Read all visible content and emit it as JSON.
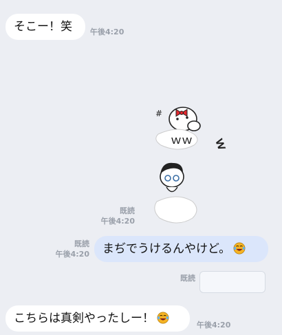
{
  "messages": [
    {
      "id": "m1",
      "direction": "incoming",
      "text": "そこー！笑",
      "time": "午後4:20"
    },
    {
      "id": "m2",
      "direction": "outgoing",
      "type": "sticker",
      "sticker_text": "ｗｗ",
      "read": "既読",
      "time": "午後4:20"
    },
    {
      "id": "m3",
      "direction": "outgoing",
      "text": "まぢでうけるんやけど。",
      "emoji": "laughing-crying-emoji",
      "read": "既読",
      "time": "午後4:20"
    },
    {
      "id": "m4",
      "direction": "outgoing",
      "text": "",
      "read": "既読",
      "time": ""
    },
    {
      "id": "m5",
      "direction": "incoming",
      "text": "こちらは真剣やったしー！",
      "emoji": "laughing-crying-emoji",
      "time": "午後4:20"
    }
  ],
  "sticker_side_text": "ｗ",
  "colors": {
    "background": "#eceef3",
    "incoming_bubble": "#ffffff",
    "outgoing_bubble": "#dbe6fb",
    "meta_text": "#9aa0aa",
    "emoji": "#f5b324"
  }
}
